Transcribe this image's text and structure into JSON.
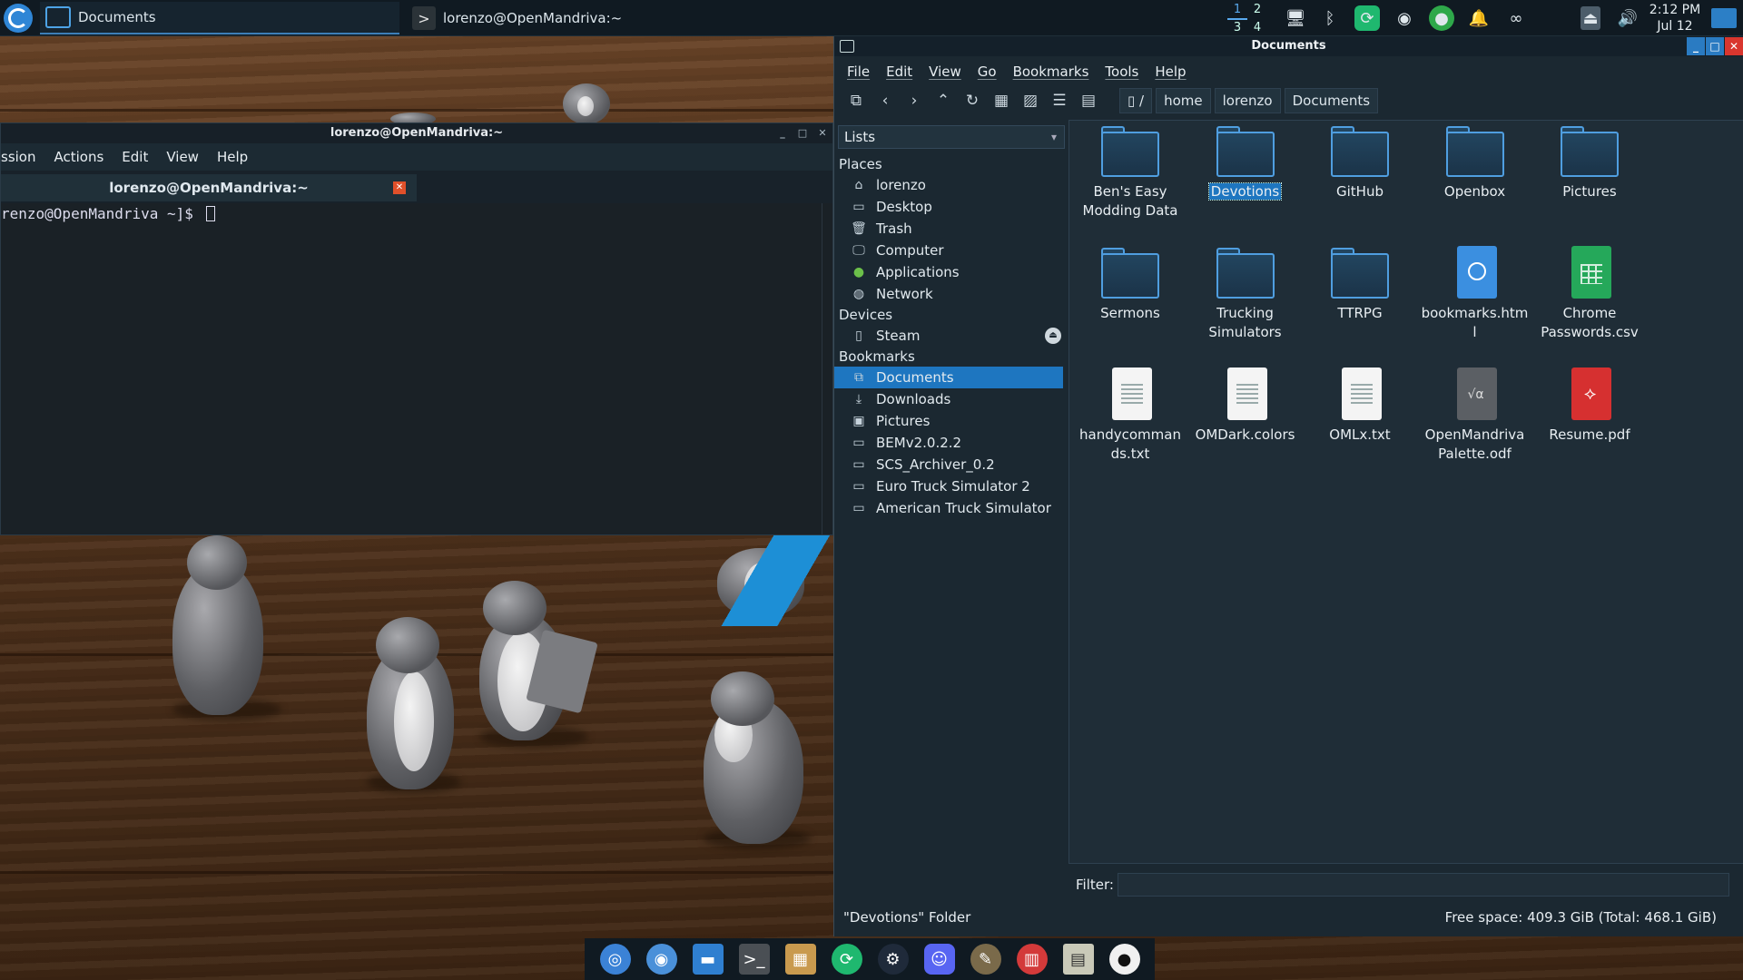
{
  "taskbar": {
    "active_task_label": "Documents",
    "terminal_task_label": "lorenzo@OpenMandriva:~",
    "pager": [
      "1",
      "2",
      "3",
      "4"
    ],
    "clock_time": "2:12 PM",
    "clock_date": "Jul 12"
  },
  "terminal": {
    "title": "lorenzo@OpenMandriva:~",
    "menu": [
      "ssion",
      "Actions",
      "Edit",
      "View",
      "Help"
    ],
    "tab_label": "lorenzo@OpenMandriva:~",
    "prompt": "renzo@OpenMandriva ~]$ "
  },
  "file_manager": {
    "title": "Documents",
    "menu": [
      "File",
      "Edit",
      "View",
      "Go",
      "Bookmarks",
      "Tools",
      "Help"
    ],
    "root_crumb": "/",
    "breadcrumbs": [
      "home",
      "lorenzo",
      "Documents"
    ],
    "side_selector": "Lists",
    "sections": {
      "places": "Places",
      "devices": "Devices",
      "bookmarks": "Bookmarks"
    },
    "places": [
      "lorenzo",
      "Desktop",
      "Trash",
      "Computer",
      "Applications",
      "Network"
    ],
    "devices": [
      "Steam"
    ],
    "bookmarks": [
      "Documents",
      "Downloads",
      "Pictures",
      "BEMv2.0.2.2",
      "SCS_Archiver_0.2",
      "Euro Truck Simulator 2",
      "American Truck Simulator"
    ],
    "files": [
      {
        "name": "Ben's Easy Modding Data",
        "kind": "folder"
      },
      {
        "name": "Devotions",
        "kind": "folder",
        "selected": true
      },
      {
        "name": "GitHub",
        "kind": "folder"
      },
      {
        "name": "Openbox",
        "kind": "folder"
      },
      {
        "name": "Pictures",
        "kind": "folder"
      },
      {
        "name": "Sermons",
        "kind": "folder"
      },
      {
        "name": "Trucking Simulators",
        "kind": "folder"
      },
      {
        "name": "TTRPG",
        "kind": "folder"
      },
      {
        "name": "bookmarks.html",
        "kind": "html"
      },
      {
        "name": "Chrome Passwords.csv",
        "kind": "csv"
      },
      {
        "name": "handycommands.txt",
        "kind": "text"
      },
      {
        "name": "OMDark.colors",
        "kind": "text"
      },
      {
        "name": "OMLx.txt",
        "kind": "text"
      },
      {
        "name": "OpenMandrivaPalette.odf",
        "kind": "odf"
      },
      {
        "name": "Resume.pdf",
        "kind": "pdf"
      }
    ],
    "filter_label": "Filter:",
    "status_left": "\"Devotions\" Folder",
    "status_right": "Free space: 409.3 GiB (Total: 468.1 GiB)"
  },
  "colors": {
    "accent": "#1e76c0",
    "folder": "#4f9ee0",
    "panel_bg": "#101a22"
  },
  "dock": [
    "chromium-icon",
    "toggle-icon",
    "files-icon",
    "terminal-icon",
    "archive-icon",
    "sync-icon",
    "steam-icon",
    "discord-icon",
    "gimp-icon",
    "book-icon",
    "document-icon",
    "github-icon"
  ]
}
